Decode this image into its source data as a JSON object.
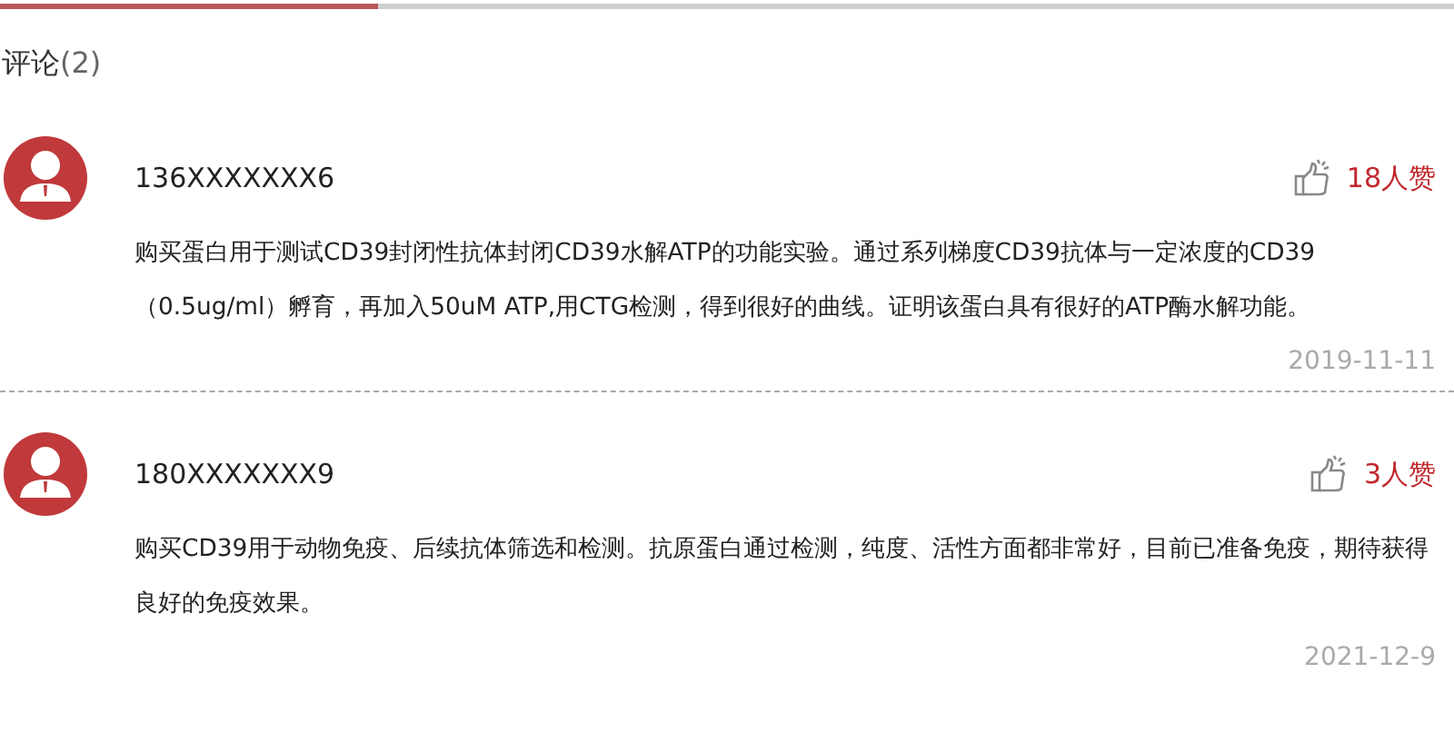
{
  "header": {
    "title": "评论",
    "count": "(2)"
  },
  "comments": [
    {
      "user": "136XXXXXXX6",
      "likes": "18人赞",
      "text": "购买蛋白用于测试CD39封闭性抗体封闭CD39水解ATP的功能实验。通过系列梯度CD39抗体与一定浓度的CD39（0.5ug/ml）孵育，再加入50uM ATP,用CTG检测，得到很好的曲线。证明该蛋白具有很好的ATP酶水解功能。",
      "date": "2019-11-11"
    },
    {
      "user": "180XXXXXXX9",
      "likes": "3人赞",
      "text": "购买CD39用于动物免疫、后续抗体筛选和检测。抗原蛋白通过检测，纯度、活性方面都非常好，目前已准备免疫，期待获得良好的免疫效果。",
      "date": "2021-12-9"
    }
  ]
}
